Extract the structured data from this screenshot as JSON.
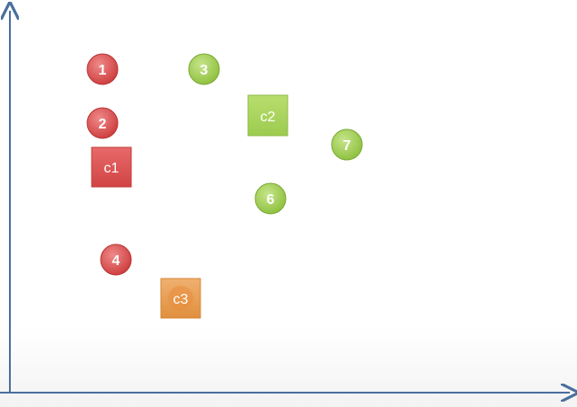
{
  "colors": {
    "axis": "#4a6f9c",
    "red": "#d94a4a",
    "green": "#9dcc4e",
    "orange": "#e8994a",
    "label": "#ffffff"
  },
  "points": [
    {
      "label": "1",
      "color": "red"
    },
    {
      "label": "2",
      "color": "red"
    },
    {
      "label": "3",
      "color": "green"
    },
    {
      "label": "4",
      "color": "red"
    },
    {
      "label": "6",
      "color": "green"
    },
    {
      "label": "7",
      "color": "green"
    }
  ],
  "centroids": [
    {
      "label": "c1",
      "color": "red"
    },
    {
      "label": "c2",
      "color": "green"
    },
    {
      "label": "c3",
      "color": "orange"
    }
  ]
}
